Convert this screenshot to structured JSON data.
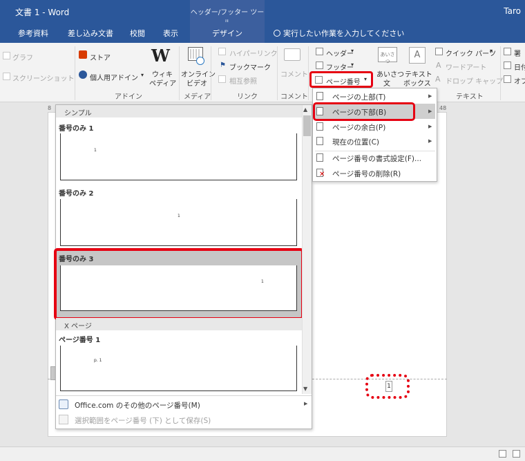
{
  "title_bar": {
    "doc_title": "文書 1 - Word",
    "context_tool": "ヘッダー/フッター ツール",
    "user": "Taro"
  },
  "tabs": {
    "references": "参考資料",
    "mailings": "差し込み文書",
    "review": "校閲",
    "view": "表示",
    "design": "デザイン",
    "tell_me": "実行したい作業を入力してください"
  },
  "ribbon": {
    "graph": "グラフ",
    "screenshot": "スクリーンショット",
    "store": "ストア",
    "personal_addins": "個人用アドイン",
    "wikipedia_l1": "ウィキ",
    "wikipedia_l2": "ペディア",
    "wiki_logo": "W",
    "online_video_l1": "オンライン",
    "online_video_l2": "ビデオ",
    "hyperlink": "ハイパーリンク",
    "bookmark": "ブックマーク",
    "cross_ref": "相互参照",
    "comment": "コメント",
    "header": "ヘッダー",
    "footer": "フッター",
    "page_number": "ページ番号",
    "greeting_l1": "あいさつ",
    "greeting_l2": "文",
    "greeting_icon": "あいさつ",
    "textbox_l1": "テキスト",
    "textbox_l2": "ボックス",
    "textbox_icon": "A",
    "quick_parts": "クイック パーツ",
    "wordart": "ワードアート",
    "dropcap": "ドロップ キャップ",
    "sig_partial": "署",
    "date_partial": "日付",
    "obj_partial": "オブ",
    "groups": {
      "addins": "アドイン",
      "media": "メディア",
      "links": "リンク",
      "comments": "コメント",
      "text": "テキスト"
    }
  },
  "ruler": {
    "left": "8",
    "right": "48"
  },
  "gallery": {
    "cat_simple": "シンプル",
    "item1": "番号のみ 1",
    "item2": "番号のみ 2",
    "item3": "番号のみ 3",
    "cat_xpage": "X ページ",
    "item4": "ページ番号 1",
    "thumb_num": "1",
    "thumb_p1": "p. 1",
    "more": "Office.com のその他のページ番号(M)",
    "save_selection": "選択範囲をページ番号 (下) として保存(S)"
  },
  "menu": {
    "top": "ページの上部(T)",
    "bottom": "ページの下部(B)",
    "margin": "ページの余白(P)",
    "current": "現在の位置(C)",
    "format": "ページ番号の書式設定(F)...",
    "remove": "ページ番号の削除(R)"
  },
  "document": {
    "footer_num": "1"
  },
  "colors": {
    "title_bar": "#2b579a",
    "highlight": "#e60012"
  }
}
